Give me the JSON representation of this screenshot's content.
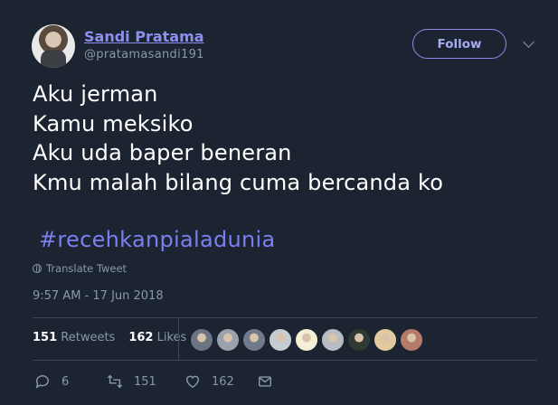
{
  "user": {
    "display_name": "Sandi Pratama",
    "handle": "@pratamasandi191"
  },
  "follow_button": {
    "label": "Follow"
  },
  "tweet": {
    "lines": [
      "Aku jerman",
      "Kamu meksiko",
      "Aku uda baper beneran",
      "Kmu malah bilang cuma bercanda ko"
    ],
    "hashtag": "#recehkanpialadunia",
    "translate_label": "Translate Tweet",
    "timestamp": "9:57 AM - 17 Jun 2018"
  },
  "stats": {
    "retweets_count": "151",
    "retweets_label": "Retweets",
    "likes_count": "162",
    "likes_label": "Likes"
  },
  "liker_avatar_colors": [
    "#6d7483",
    "#9aa3ad",
    "#707a88",
    "#c7ccd3",
    "#f3f0d6",
    "#b9bcc0",
    "#2f3a34",
    "#e4c9a0",
    "#b57b6a"
  ],
  "actions": {
    "reply_count": "6",
    "retweet_count": "151",
    "like_count": "162"
  },
  "colors": {
    "background": "#1c2431",
    "accent": "#8f8ff0",
    "secondary_text": "#8899a6"
  }
}
